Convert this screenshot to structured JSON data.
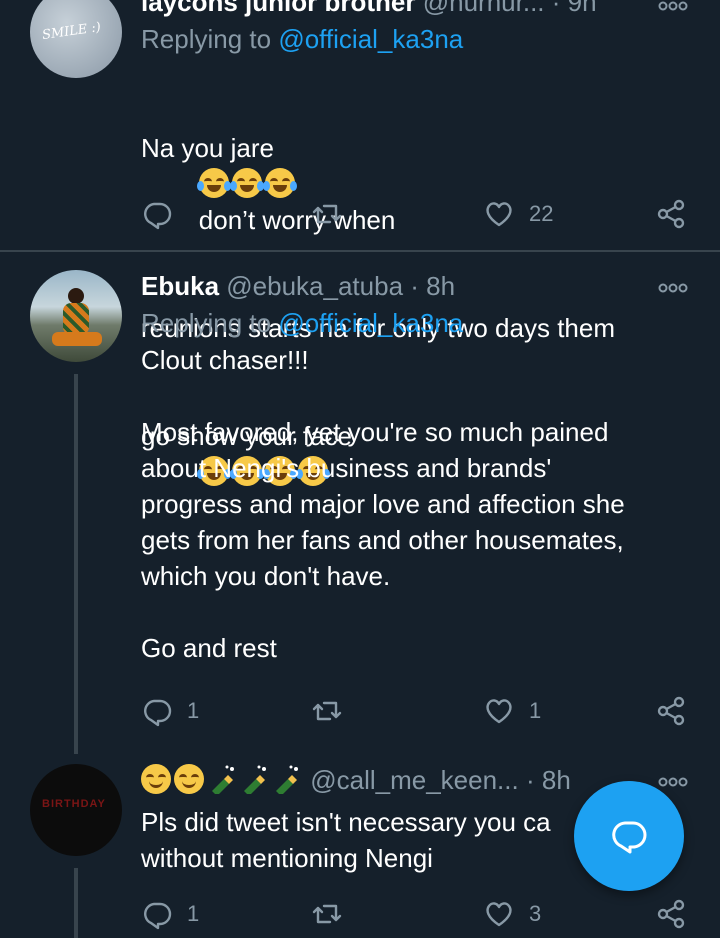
{
  "tweets": [
    {
      "display_name": "laycons junior brother",
      "handle": "@nurnur...",
      "time": "9h",
      "dot": "·",
      "replying_prefix": "Replying to",
      "replying_handle": "@official_ka3na",
      "body_line1": "Na you jare",
      "body_line1b": "don’t worry when",
      "body_line2": "reunions starts na for only two days them",
      "body_line3": "go show your face",
      "emoji_set_1": "😂😂😂",
      "emoji_set_2": "😂😂😂😂",
      "replies": "",
      "likes": "22"
    },
    {
      "display_name": "Ebuka",
      "handle": "@ebuka_atuba",
      "time": "8h",
      "dot": "·",
      "replying_prefix": "Replying to",
      "replying_handle": "@official_ka3na",
      "body": "Clout chaser!!!\n\nMost favored, yet you're so much pained\nabout Nengi's business and brands'\nprogress and major love and affection she\ngets from her fans and other housemates,\nwhich you don't have.\n\nGo and rest",
      "replies": "1",
      "likes": "1"
    },
    {
      "display_name_emoji": "😌😌🍾🍾🍾",
      "handle": "@call_me_keen...",
      "time": "8h",
      "dot": "·",
      "avatar_text": "BIRTHDAY",
      "body": "Pls did tweet isn't necessary you ca\nwithout mentioning Nengi",
      "replies": "1",
      "likes": "3"
    }
  ],
  "avatar_1_text": "SMILE :)",
  "icons": [
    "reply-icon",
    "retweet-icon",
    "like-icon",
    "share-icon",
    "more-icon",
    "compose-icon"
  ],
  "colors": {
    "background": "#15202b",
    "accent": "#1da1f2",
    "muted": "#8899a6",
    "divider": "#38444d"
  }
}
